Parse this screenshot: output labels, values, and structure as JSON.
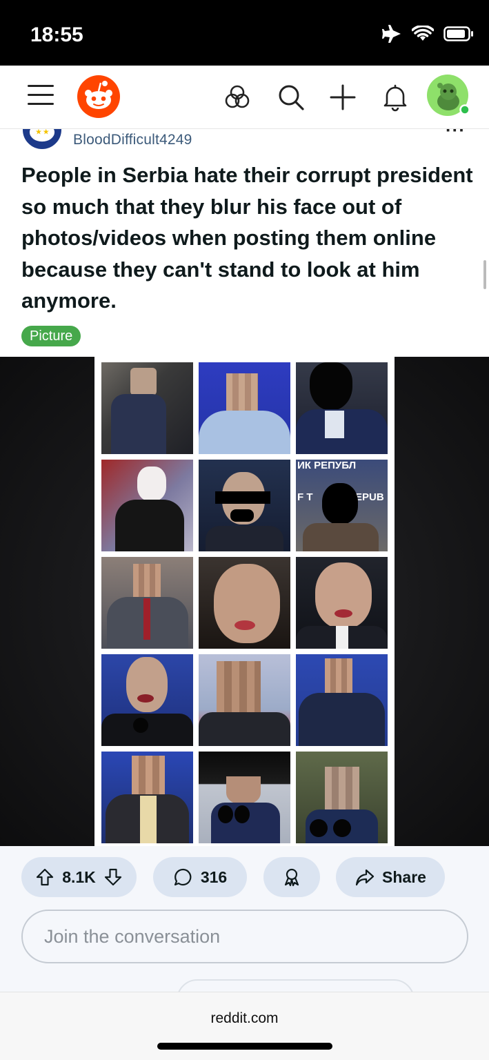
{
  "status_bar": {
    "time": "18:55",
    "icons": [
      "airplane-icon",
      "wifi-icon",
      "battery-icon"
    ]
  },
  "header": {
    "icons": [
      "hamburger-menu-icon",
      "reddit-logo",
      "communities-icon",
      "search-icon",
      "create-post-icon",
      "notifications-icon",
      "user-avatar"
    ]
  },
  "post": {
    "author": "BloodDifficult4249",
    "title": "People in Serbia hate their corrupt president so much that they blur his face out of photos/videos when posting them online because they can't stand to look at him anymore.",
    "flair": "Picture",
    "image_overlay_text": [
      "ИК РЕПУБЛ",
      "F T",
      "EPUB"
    ]
  },
  "actions": {
    "votes": "8.1K",
    "comments": "316",
    "share_label": "Share"
  },
  "comment_input": {
    "placeholder": "Join the conversation"
  },
  "footer": {
    "url": "reddit.com"
  },
  "colors": {
    "flair_bg": "#46a84b",
    "pill_bg": "#dbe4f1",
    "reddit_orange": "#ff4500"
  }
}
